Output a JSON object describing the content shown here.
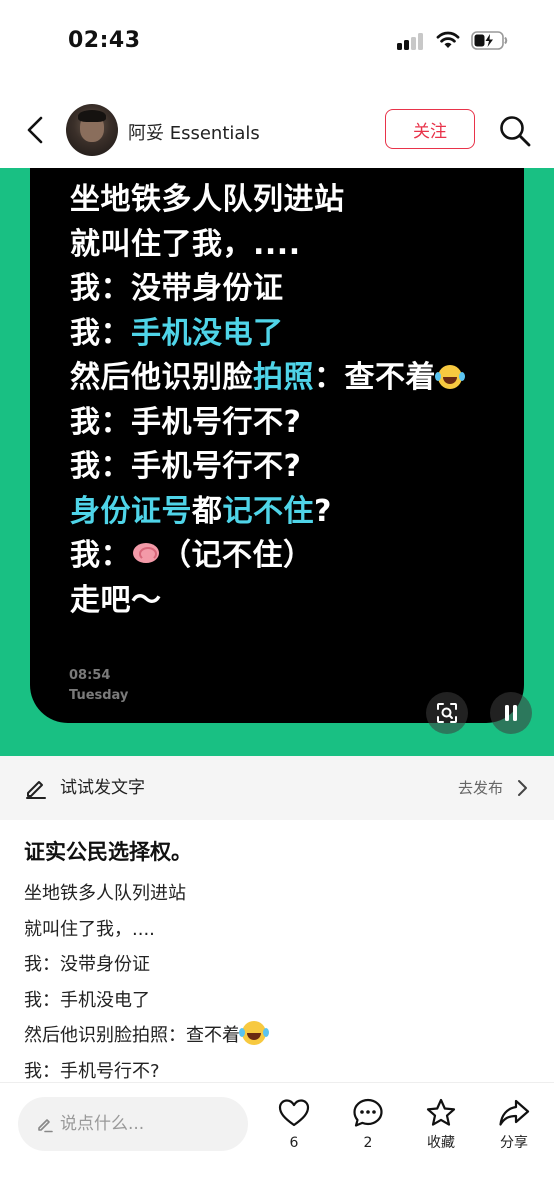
{
  "status_bar": {
    "time": "02:43"
  },
  "header": {
    "author_name": "阿妥 Essentials",
    "follow_label": "关注"
  },
  "note_card": {
    "lines": [
      {
        "segments": [
          {
            "text": "坐地铁多人队列进站",
            "highlight": false
          }
        ]
      },
      {
        "segments": [
          {
            "text": "就叫住了我，....",
            "highlight": false
          }
        ]
      },
      {
        "segments": [
          {
            "text": "我：没带身份证",
            "highlight": false
          }
        ]
      },
      {
        "segments": [
          {
            "text": "我：",
            "highlight": false
          },
          {
            "text": "手机没电了",
            "highlight": true
          }
        ]
      },
      {
        "segments": [
          {
            "text": "然后他识别脸",
            "highlight": false
          },
          {
            "text": "拍照",
            "highlight": true
          },
          {
            "text": "：查不着",
            "highlight": false
          }
        ],
        "emoji": "face-with-tears-of-joy"
      },
      {
        "segments": [
          {
            "text": "我：手机号行不?",
            "highlight": false
          }
        ]
      },
      {
        "segments": [
          {
            "text": "我：手机号行不?",
            "highlight": false
          }
        ]
      },
      {
        "segments": [
          {
            "text": "身份证号",
            "highlight": true
          },
          {
            "text": "都",
            "highlight": false
          },
          {
            "text": "记不住",
            "highlight": true
          },
          {
            "text": "?",
            "highlight": false
          }
        ]
      },
      {
        "segments": [
          {
            "text": "我：",
            "highlight": false
          }
        ],
        "emoji_inline": "brain",
        "after_emoji": "（记不住）"
      },
      {
        "segments": [
          {
            "text": "走吧～",
            "highlight": false
          }
        ]
      }
    ],
    "time": "08:54",
    "day": "Tuesday"
  },
  "try_bar": {
    "label": "试试发文字",
    "action": "去发布"
  },
  "post": {
    "title": "证实公民选择权。",
    "lines": [
      "坐地铁多人队列进站",
      "就叫住了我，....",
      "我：没带身份证",
      "我：手机没电了",
      "然后他识别脸拍照：查不着",
      "我：手机号行不?"
    ]
  },
  "bottom_bar": {
    "comment_placeholder": "说点什么...",
    "like_count": "6",
    "comment_count": "2",
    "collect_label": "收藏",
    "share_label": "分享"
  },
  "colors": {
    "accent_red": "#e8334a",
    "media_green": "#19c083",
    "note_highlight": "#4fd4e8"
  },
  "icons": [
    "back-icon",
    "search-icon",
    "scan-icon",
    "pause-icon",
    "edit-icon",
    "chevron-right-icon",
    "heart-icon",
    "comment-icon",
    "star-icon",
    "share-icon"
  ]
}
